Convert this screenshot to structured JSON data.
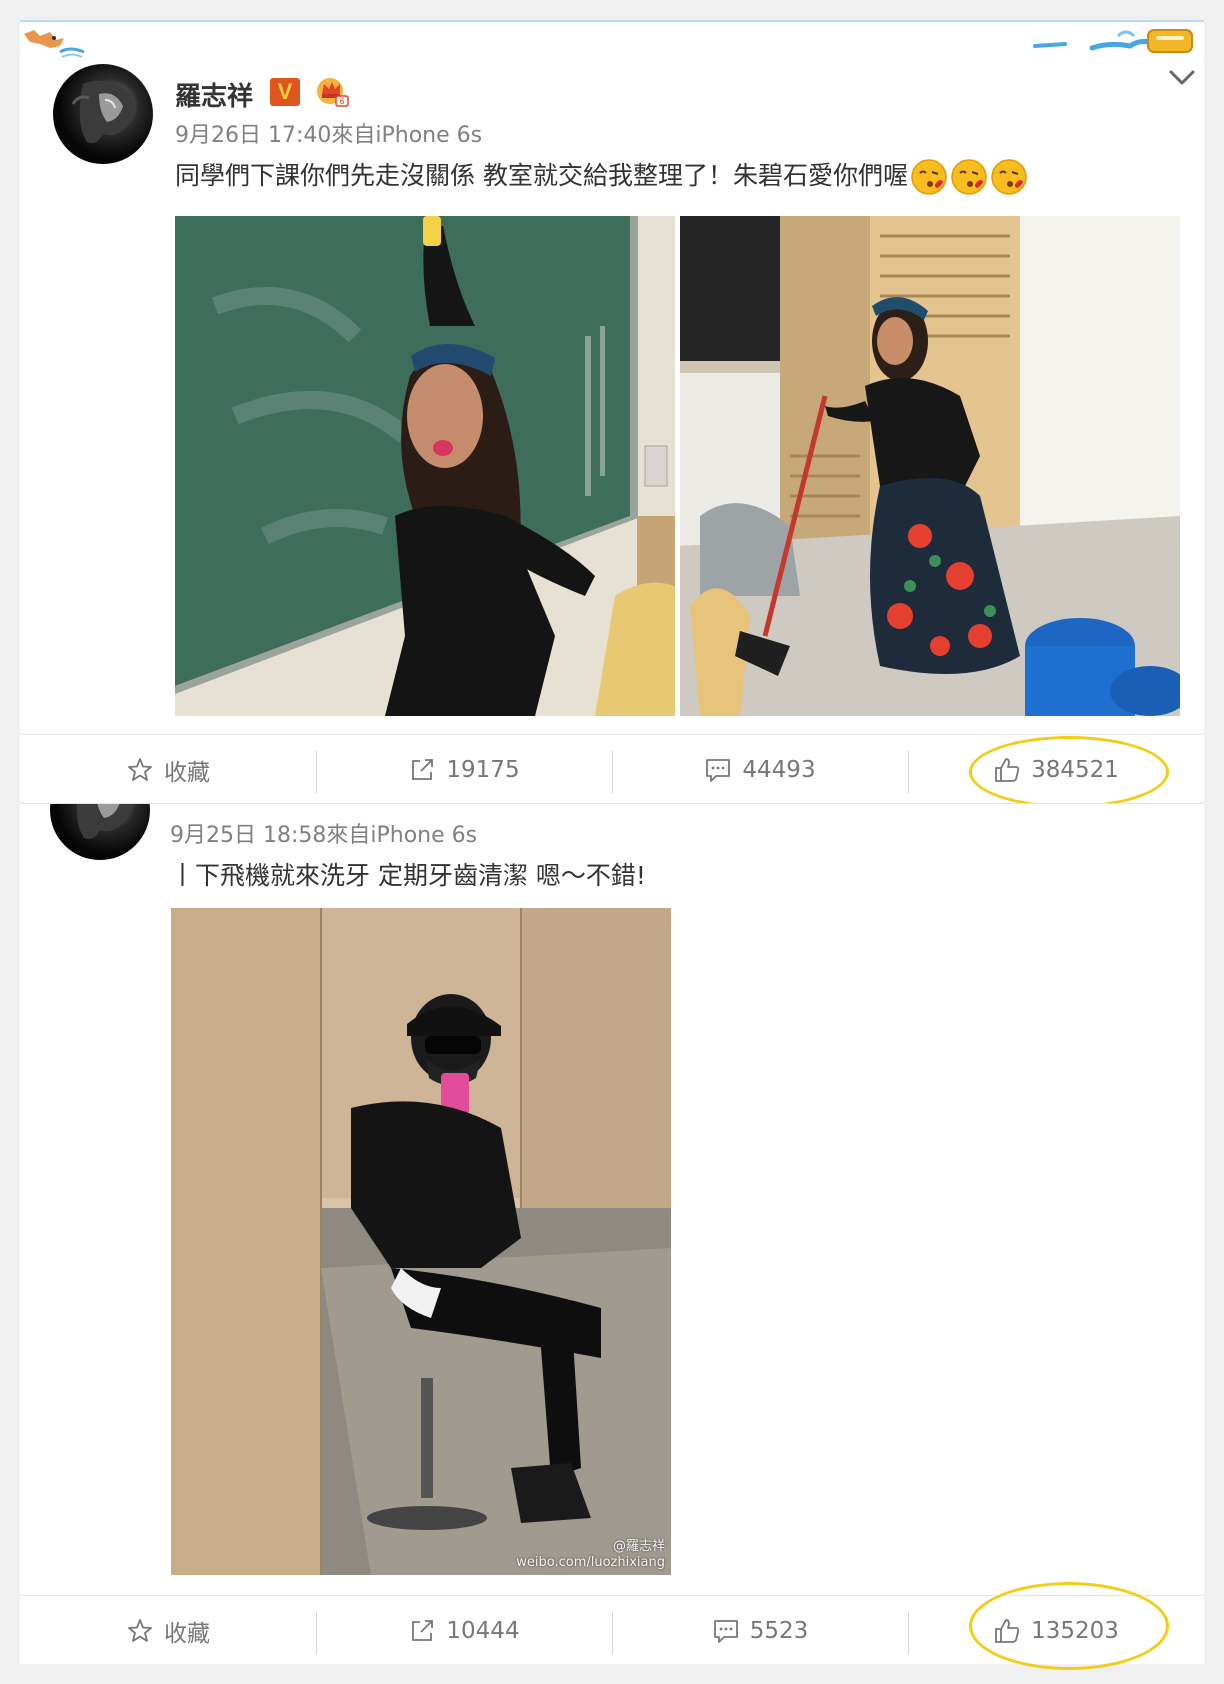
{
  "posts": [
    {
      "author": "羅志祥",
      "badge": "V",
      "time_source": "9月26日 17:40來自iPhone 6s",
      "text": "同學們下課你們先走沒關係 教室就交給我整理了！朱碧石愛你們喔",
      "emoji_count": 3,
      "actions": {
        "favorite": "收藏",
        "repost": "19175",
        "comment": "44493",
        "like": "384521"
      }
    },
    {
      "time_source": "9月25日 18:58來自iPhone 6s",
      "text": "丨下飛機就來洗牙 定期牙齒清潔 嗯～不錯!",
      "watermark_line1": "@羅志祥",
      "watermark_line2": "weibo.com/luozhixiang",
      "actions": {
        "favorite": "收藏",
        "repost": "10444",
        "comment": "5523",
        "like": "135203"
      }
    }
  ],
  "icons": {
    "favorite": "star-outline-icon",
    "repost": "share-arrow-icon",
    "comment": "comment-bubble-icon",
    "like": "thumbs-up-icon",
    "collapse": "chevron-down-icon"
  },
  "colors": {
    "highlight_ring": "#f2cd17",
    "verified_badge": "#e0551f",
    "meta_text": "#808080"
  }
}
